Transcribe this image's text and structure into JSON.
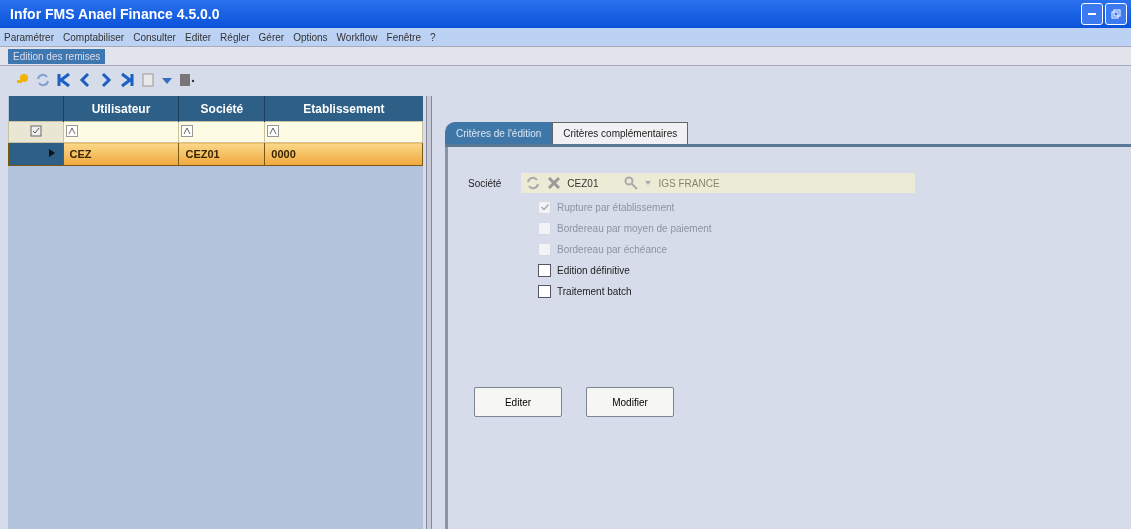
{
  "window": {
    "title": "Infor FMS Anael Finance 4.5.0.0"
  },
  "menu": [
    "Paramétrer",
    "Comptabiliser",
    "Consulter",
    "Editer",
    "Régler",
    "Gérer",
    "Options",
    "Workflow",
    "Fenêtre",
    "?"
  ],
  "document_tab": {
    "label": "Edition des remises"
  },
  "grid": {
    "columns": [
      "Utilisateur",
      "Société",
      "Etablissement"
    ],
    "rows": [
      {
        "selected": true,
        "cells": [
          "CEZ",
          "CEZ01",
          "0000"
        ]
      }
    ]
  },
  "tabs": [
    {
      "label": "Critères de l'édition",
      "selected": true
    },
    {
      "label": "Critères complémentaires",
      "selected": false
    }
  ],
  "form": {
    "societe_label": "Société",
    "societe_code": "CEZ01",
    "societe_name": "IGS FRANCE",
    "options": [
      {
        "label": "Rupture par établissement",
        "checked": true,
        "disabled": true
      },
      {
        "label": "Bordereau par moyen de paiement",
        "checked": false,
        "disabled": true
      },
      {
        "label": "Bordereau par échéance",
        "checked": false,
        "disabled": true
      },
      {
        "label": "Edition définitive",
        "checked": false,
        "disabled": false
      },
      {
        "label": "Traitement batch",
        "checked": false,
        "disabled": false
      }
    ]
  },
  "buttons": [
    "Editer",
    "Modifier"
  ]
}
